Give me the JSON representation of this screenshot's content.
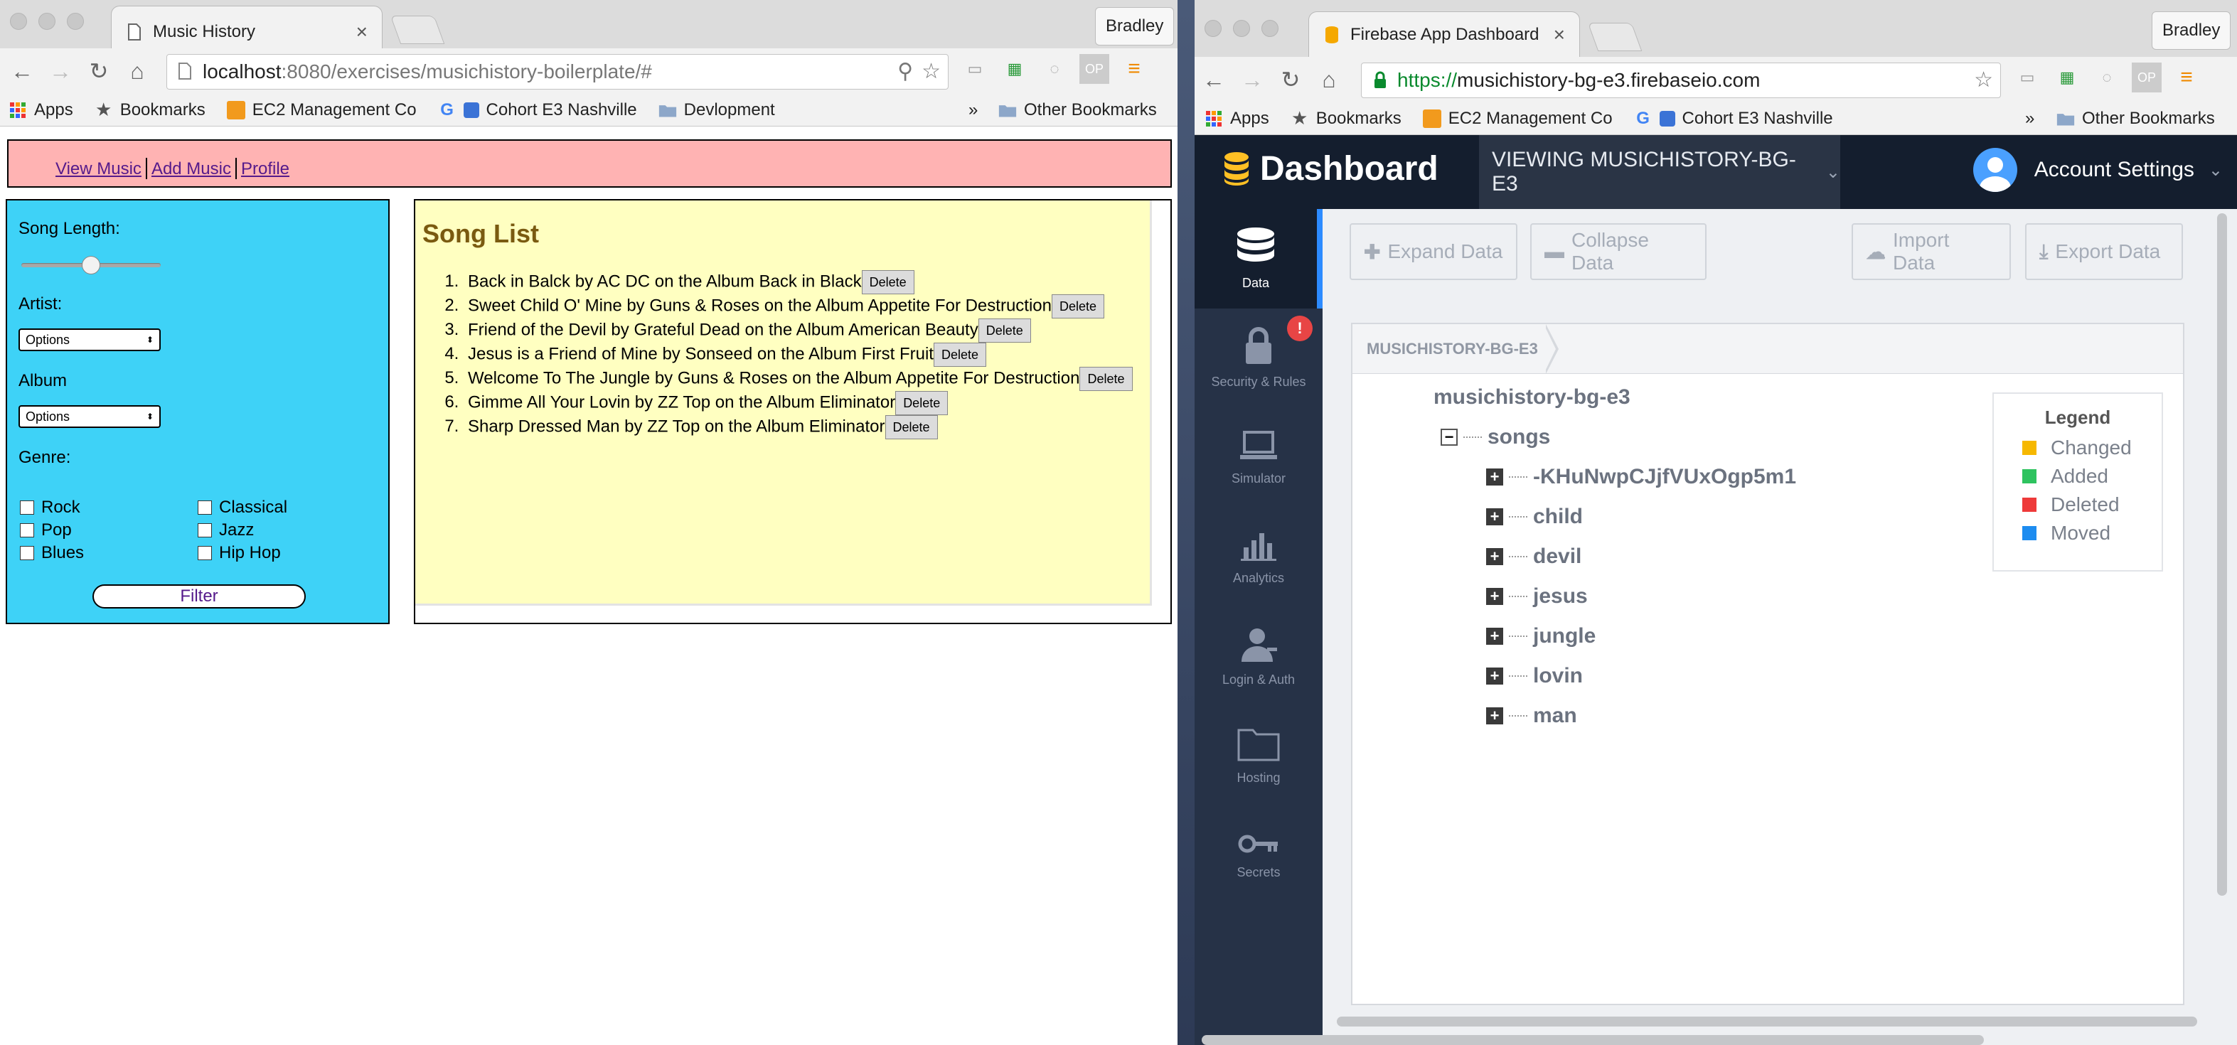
{
  "left_browser": {
    "tab_title": "Music History",
    "user": "Bradley",
    "url_host": "localhost",
    "url_path": ":8080/exercises/musichistory-boilerplate/#",
    "bookmarks": [
      "Apps",
      "Bookmarks",
      "EC2 Management Co",
      "Cohort E3 Nashville",
      "Devlopment"
    ],
    "other_bookmarks": "Other Bookmarks",
    "overflow": "»"
  },
  "music_app": {
    "nav": [
      "View Music",
      "Add Music",
      "Profile"
    ],
    "song_length_label": "Song Length:",
    "song_length_value": 0.5,
    "artist_label": "Artist:",
    "artist_select": "Options",
    "album_label": "Album",
    "album_select": "Options",
    "genre_label": "Genre:",
    "genres": [
      "Rock",
      "Classical",
      "Pop",
      "Jazz",
      "Blues",
      "Hip Hop"
    ],
    "filter_label": "Filter",
    "song_list_title": "Song List",
    "delete_label": "Delete",
    "songs": [
      "Back in Balck by AC DC on the Album Back in Black",
      "Sweet Child O' Mine by Guns & Roses on the Album Appetite For Destruction",
      "Friend of the Devil by Grateful Dead on the Album American Beauty",
      "Jesus is a Friend of Mine by Sonseed on the Album First Fruit",
      "Welcome To The Jungle by Guns & Roses on the Album Appetite For Destruction",
      "Gimme All Your Lovin by ZZ Top on the Album Eliminator",
      "Sharp Dressed Man by ZZ Top on the Album Eliminator"
    ]
  },
  "right_browser": {
    "tab_title": "Firebase App Dashboard",
    "user": "Bradley",
    "url_scheme": "https://",
    "url_host": "musichistory-bg-e3.firebaseio.com",
    "bookmarks": [
      "Apps",
      "Bookmarks",
      "EC2 Management Co",
      "Cohort E3 Nashville",
      "Other Bookmarks"
    ],
    "overflow": "»"
  },
  "firebase": {
    "logo": "Dashboard",
    "viewing": "VIEWING MUSICHISTORY-BG-E3",
    "account": "Account Settings",
    "sidebar": [
      "Data",
      "Security & Rules",
      "Simulator",
      "Analytics",
      "Login & Auth",
      "Hosting",
      "Secrets"
    ],
    "security_badge": "!",
    "toolbar": [
      "Expand Data",
      "Collapse Data",
      "Import Data",
      "Export Data"
    ],
    "breadcrumb": "MUSICHISTORY-BG-E3",
    "root": "musichistory-bg-e3",
    "songs_node": "songs",
    "children": [
      "-KHuNwpCJjfVUxOgp5m1",
      "child",
      "devil",
      "jesus",
      "jungle",
      "lovin",
      "man"
    ],
    "legend_title": "Legend",
    "legend": [
      {
        "label": "Changed",
        "color": "#f6b800"
      },
      {
        "label": "Added",
        "color": "#2ec35f"
      },
      {
        "label": "Deleted",
        "color": "#ee3a3a"
      },
      {
        "label": "Moved",
        "color": "#1d8cf0"
      }
    ]
  }
}
